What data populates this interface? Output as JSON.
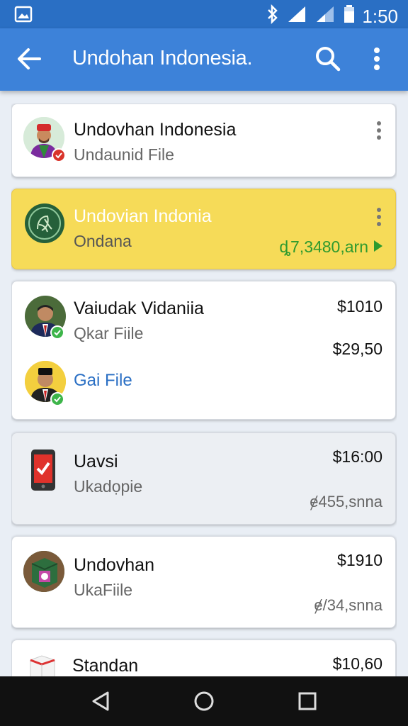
{
  "status_bar": {
    "time": "1:50",
    "icons": [
      "gallery-icon",
      "bluetooth-icon",
      "signal-icon",
      "signal-icon",
      "battery-icon"
    ]
  },
  "app_bar": {
    "title": "Undohan Indonesia.",
    "icons": [
      "back-arrow-icon",
      "search-icon",
      "more-vert-icon"
    ]
  },
  "colors": {
    "primary": "#3d82d9",
    "status_bar": "#2a6fc4",
    "highlight_card": "#f6db58",
    "green_text": "#2e9a2e",
    "link_blue": "#2a6fc4",
    "badge_green": "#3db54a",
    "badge_red": "#d9342b"
  },
  "items": [
    {
      "title": "Undovhan Indonesia",
      "subtitle": "Undaunid File"
    },
    {
      "title": "Undovian Indonia",
      "subtitle": "Ondana",
      "amount": "ȡ7,3480,arn"
    },
    {
      "title": "Vaiudak Vidaniia",
      "subtitle": "Qkar Fiile",
      "price": "$1010",
      "price2": "$29,50",
      "sub_item_label": "Gai File"
    },
    {
      "title": "Uavsi",
      "subtitle": "Ukadọpie",
      "price": "$16:00",
      "note": "ɇ455,snna"
    },
    {
      "title": "Undovhan",
      "subtitle": "UkaFiile",
      "price": "$1910",
      "note": "ɇ/34,snna"
    },
    {
      "title": "Standan",
      "price": "$10,60"
    }
  ],
  "nav_bar": {
    "icons": [
      "back-triangle-icon",
      "home-circle-icon",
      "recents-square-icon"
    ]
  }
}
